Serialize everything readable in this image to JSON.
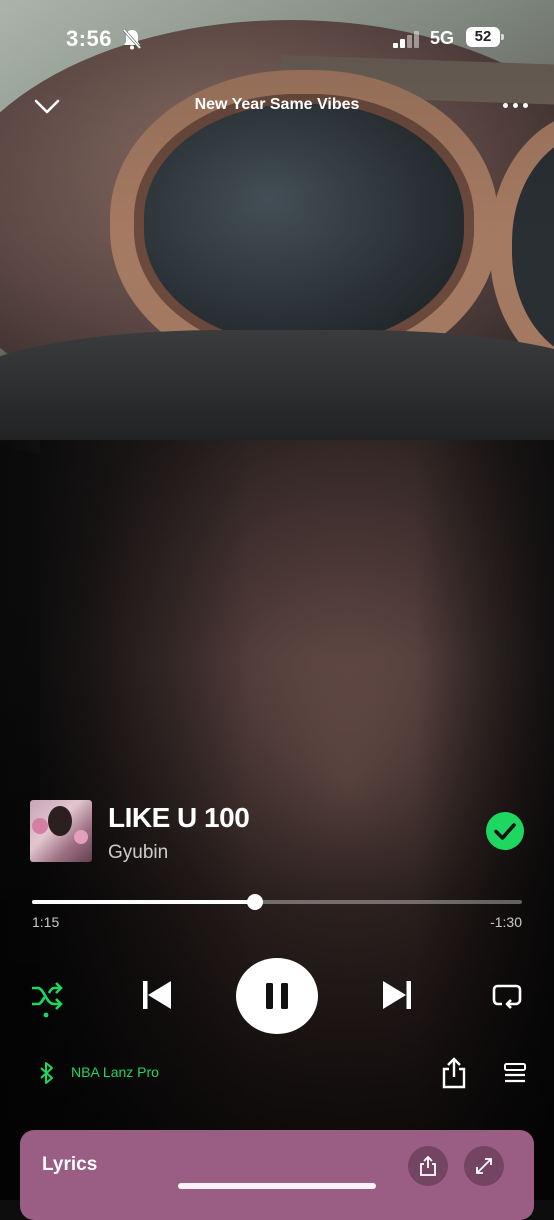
{
  "status_bar": {
    "time": "3:56",
    "network": "5G",
    "battery": "52",
    "icons": [
      "bell-slash-icon",
      "signal-icon"
    ]
  },
  "header": {
    "context_title": "New Year Same Vibes",
    "icons": [
      "chevron-down-icon",
      "more-icon"
    ]
  },
  "track": {
    "title": "LIKE U 100",
    "artist": "Gyubin",
    "saved": true,
    "icons": [
      "album-cover",
      "check-circle-icon"
    ]
  },
  "progress": {
    "elapsed": "1:15",
    "remaining": "-1:30",
    "fraction": 0.455
  },
  "controls": {
    "shuffle_active": true,
    "playing": true,
    "icons": [
      "shuffle-icon",
      "previous-icon",
      "pause-icon",
      "next-icon",
      "repeat-icon"
    ]
  },
  "device": {
    "name": "NBA Lanz Pro",
    "icons": [
      "bluetooth-icon",
      "share-icon",
      "queue-icon"
    ]
  },
  "lyrics_card": {
    "title": "Lyrics",
    "icons": [
      "share-icon",
      "expand-icon"
    ]
  },
  "colors": {
    "accent": "#1ed760",
    "lyrics_card": "#9a5d83"
  }
}
